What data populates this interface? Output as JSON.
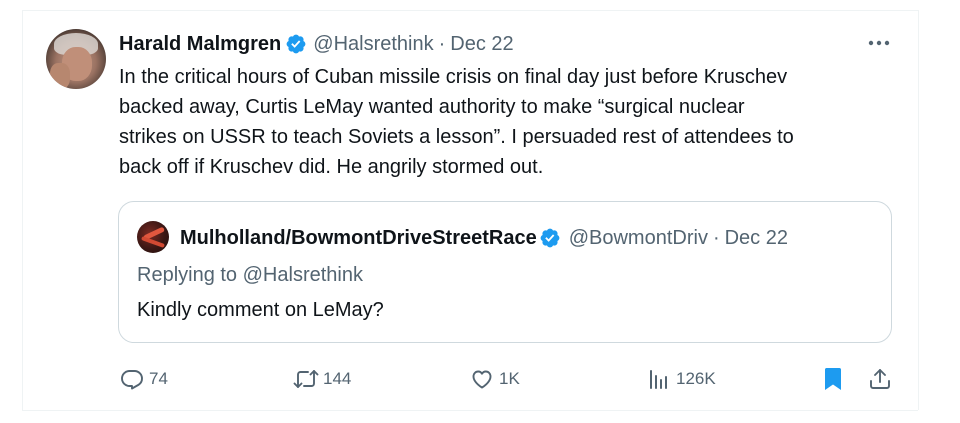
{
  "tweet": {
    "author": {
      "name": "Harald Malmgren",
      "handle": "@Halsrethink",
      "verified": true
    },
    "separator": "·",
    "date": "Dec 22",
    "text": "In the critical hours of Cuban missile crisis on final day just before Kruschev\nbacked away, Curtis LeMay wanted authority to make “surgical nuclear\nstrikes on USSR to teach Soviets a lesson”. I persuaded rest of attendees to\nback off if Kruschev did. He angrily stormed out.",
    "quoted": {
      "name": "Mulholland/BowmontDriveStreetRace",
      "handle": "@BowmontDriv",
      "separator": "·",
      "date": "Dec 22",
      "replying_prefix": "Replying to ",
      "replying_to": "@Halsrethink",
      "text": "Kindly comment on LeMay?"
    },
    "actions": {
      "replies": "74",
      "reposts": "144",
      "likes": "1K",
      "views": "126K"
    }
  },
  "colors": {
    "text": "#0f1419",
    "secondary": "#536471",
    "verified": "#1d9bf0",
    "bookmark": "#1d9bf0",
    "border": "#cfd9de"
  },
  "icons": {
    "verified": "verified-badge-icon",
    "more": "more-dots-icon",
    "reply": "reply-bubble-icon",
    "repost": "repost-arrows-icon",
    "like": "heart-icon",
    "views": "views-bars-icon",
    "bookmark": "bookmark-filled-icon",
    "share": "share-upload-icon"
  }
}
